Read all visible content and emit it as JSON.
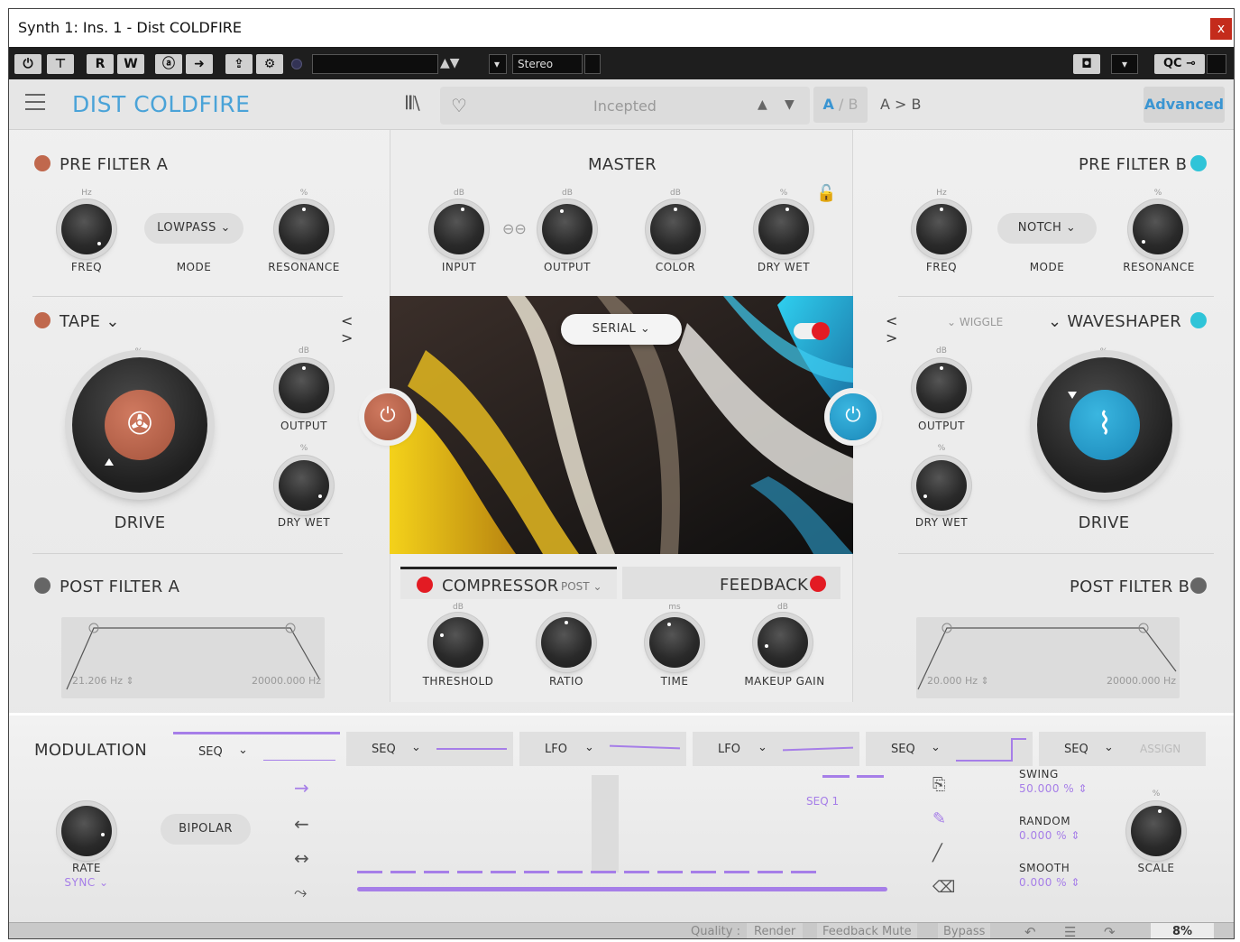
{
  "window": {
    "title": "Synth 1: Ins. 1 - Dist COLDFIRE",
    "close_label": "x"
  },
  "host_toolbar": {
    "read_label": "R",
    "write_label": "W",
    "preset_field": "",
    "channel_mode": "Stereo"
  },
  "plugin": {
    "name": "DIST COLDFIRE",
    "preset_name": "Incepted",
    "ab_a": "A",
    "ab_sep": "/",
    "ab_b": "B",
    "ab_copy": "A > B",
    "advanced_label": "Advanced"
  },
  "pre_filter_a": {
    "title": "PRE FILTER A",
    "mode": "LOWPASS",
    "freq_label": "FREQ",
    "mode_label": "MODE",
    "res_label": "RESONANCE",
    "freq_unit": "Hz",
    "res_unit": "%"
  },
  "pre_filter_b": {
    "title": "PRE FILTER B",
    "mode": "NOTCH",
    "freq_label": "FREQ",
    "mode_label": "MODE",
    "res_label": "RESONANCE",
    "freq_unit": "Hz",
    "res_unit": "%"
  },
  "master": {
    "title": "MASTER",
    "input_label": "INPUT",
    "output_label": "OUTPUT",
    "color_label": "COLOR",
    "drywet_label": "DRY  WET",
    "unit_db": "dB",
    "unit_pct": "%",
    "routing": "SERIAL"
  },
  "tape": {
    "title": "TAPE",
    "drive_label": "DRIVE",
    "output_label": "OUTPUT",
    "drywet_label": "DRY WET",
    "nav": "< >",
    "unit_db": "dB",
    "unit_pct": "%"
  },
  "waveshaper": {
    "title": "WAVESHAPER",
    "sub": "WIGGLE",
    "drive_label": "DRIVE",
    "output_label": "OUTPUT",
    "drywet_label": "DRY WET",
    "nav": "< >",
    "unit_db": "dB",
    "unit_pct": "%"
  },
  "post_filter_a": {
    "title": "POST FILTER A",
    "low": "21.206 Hz",
    "high": "20000.000 Hz"
  },
  "post_filter_b": {
    "title": "POST FILTER B",
    "low": "20.000 Hz",
    "high": "20000.000 Hz"
  },
  "compressor": {
    "title": "COMPRESSOR",
    "position": "POST",
    "threshold_label": "THRESHOLD",
    "ratio_label": "RATIO",
    "time_label": "TIME",
    "makeup_label": "MAKEUP GAIN",
    "unit_db": "dB",
    "unit_ms": "ms"
  },
  "feedback": {
    "title": "FEEDBACK"
  },
  "modulation": {
    "title": "MODULATION",
    "tabs": [
      {
        "type": "SEQ"
      },
      {
        "type": "SEQ"
      },
      {
        "type": "LFO"
      },
      {
        "type": "LFO"
      },
      {
        "type": "SEQ"
      },
      {
        "type": "SEQ",
        "extra": "ASSIGN"
      }
    ],
    "rate_label": "RATE",
    "rate_mode": "SYNC",
    "bipolar_label": "BIPOLAR",
    "seq_name": "SEQ 1",
    "swing_label": "SWING",
    "swing_value": "50.000 %",
    "random_label": "RANDOM",
    "random_value": "0.000 %",
    "smooth_label": "SMOOTH",
    "smooth_value": "0.000 %",
    "scale_label": "SCALE",
    "scale_unit": "%",
    "colors": {
      "accent": "#a67ee8",
      "blue": "#4aa3d8",
      "orange": "#c0684d",
      "teal": "#2fc4d8",
      "red": "#e31b23"
    }
  },
  "status": {
    "quality_label": "Quality :",
    "render_label": "Render",
    "feedback_mute_label": "Feedback Mute",
    "bypass_label": "Bypass",
    "cpu": "8%"
  }
}
